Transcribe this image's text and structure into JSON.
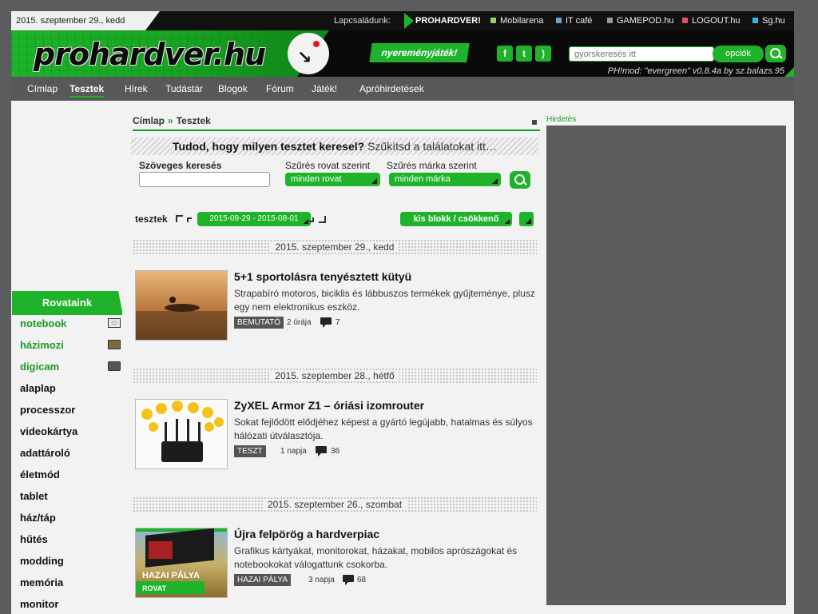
{
  "topbar": {
    "date": "2015. szeptember 29., kedd",
    "family_label": "Lapcsaládunk:",
    "sites": [
      {
        "label": "PROHARDVER!",
        "color": "#1fb32b"
      },
      {
        "label": "Mobilarena",
        "color": "#8fd36b"
      },
      {
        "label": "IT café",
        "color": "#6aa6d8"
      },
      {
        "label": "GAMEPOD.hu",
        "color": "#999999"
      },
      {
        "label": "LOGOUT.hu",
        "color": "#e0506a"
      },
      {
        "label": "Sg.hu",
        "color": "#35b7e0"
      }
    ]
  },
  "header": {
    "logo": "prohardver.hu",
    "promo": "nyereményjáték!",
    "social": [
      "facebook-icon",
      "twitter-icon",
      "rss-icon"
    ],
    "search_placeholder": "gyorskeresés itt",
    "options_label": "opciók",
    "version": "PH!mod: \"evergreen\" v0.8.4a by sz.balazs.95"
  },
  "nav": [
    "Címlap",
    "Tesztek",
    "Hírek",
    "Tudástár",
    "Blogok",
    "Fórum",
    "Játék!",
    "Apróhirdetések"
  ],
  "nav_active": "Tesztek",
  "sidebar": {
    "title": "Rovataink",
    "categories": [
      {
        "label": "notebook",
        "icon": "notebook-icon",
        "green": true
      },
      {
        "label": "házimozi",
        "icon": "tv-icon",
        "green": true
      },
      {
        "label": "digicam",
        "icon": "camera-icon",
        "green": true
      },
      {
        "label": "alaplap"
      },
      {
        "label": "processzor"
      },
      {
        "label": "videokártya"
      },
      {
        "label": "adattároló"
      },
      {
        "label": "életmód"
      },
      {
        "label": "tablet"
      },
      {
        "label": "ház/táp"
      },
      {
        "label": "hűtés"
      },
      {
        "label": "modding"
      },
      {
        "label": "memória"
      },
      {
        "label": "monitor"
      }
    ]
  },
  "breadcrumb": {
    "home": "Címlap",
    "sep": "»",
    "current": "Tesztek"
  },
  "filter": {
    "banner_bold": "Tudod, hogy milyen tesztet keresel?",
    "banner_rest": "Szűkítsd a találatokat itt…",
    "text_label": "Szöveges keresés",
    "section_label": "Szűrés rovat szerint",
    "section_value": "minden rovat",
    "brand_label": "Szűrés márka szerint",
    "brand_value": "minden márka"
  },
  "listing": {
    "label": "tesztek",
    "date_range": "2015-09-29 - 2015-08-01",
    "view_mode": "kis blokk / csökkenő"
  },
  "groups": [
    {
      "date": "2015. szeptember 29., kedd",
      "article": {
        "title": "5+1 sportolásra tenyésztett kütyü",
        "desc": "Strapabíró motoros, biciklis és lábbuszos termékek gyűjteménye, plusz egy nem elektronikus eszköz.",
        "tag": "BEMUTATÓ",
        "time": "2 órája",
        "comments": "7"
      }
    },
    {
      "date": "2015. szeptember 28., hétfő",
      "article": {
        "title": "ZyXEL Armor Z1 – óriási izomrouter",
        "desc": "Sokat fejlődött elődjéhez képest a gyártó legújabb, hatalmas és súlyos hálózati útválasztója.",
        "tag": "TESZT",
        "time": "1 napja",
        "comments": "36"
      }
    },
    {
      "date": "2015. szeptember 26., szombat",
      "article": {
        "title": "Újra felpörög a hardverpiac",
        "desc": "Grafikus kártyákat, monitorokat, házakat, mobilos aprószágokat és notebookokat válogattunk csokorba.",
        "tag": "HAZAI PÁLYA",
        "time": "3 napja",
        "comments": "68",
        "thumb_text": [
          "HAZAI PÁLYA",
          "ROVAT"
        ]
      }
    }
  ],
  "ad_label": "Hirdetés"
}
